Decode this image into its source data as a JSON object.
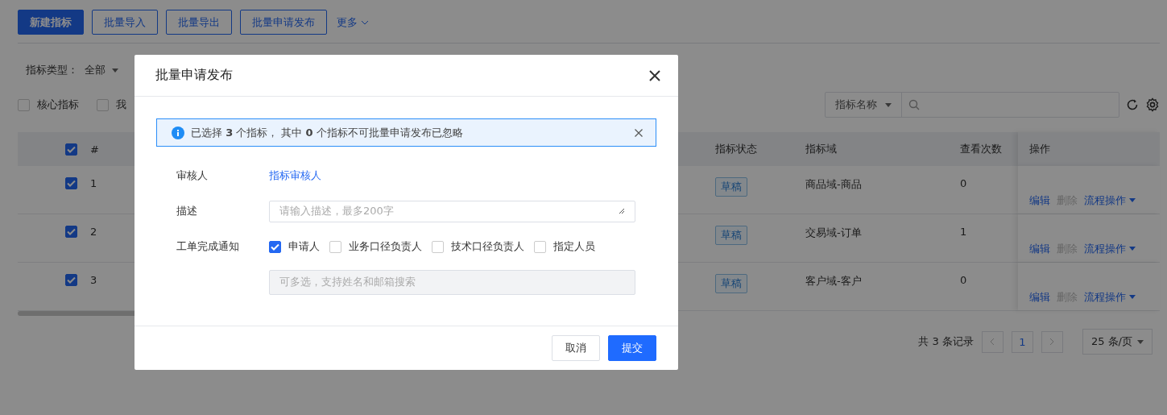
{
  "toolbar": [
    {
      "label": "新建指标",
      "kind": "primary"
    },
    {
      "label": "批量导入",
      "kind": "outline"
    },
    {
      "label": "批量导出",
      "kind": "outline"
    },
    {
      "label": "批量申请发布",
      "kind": "outline"
    },
    {
      "label": "更多",
      "kind": "dropdown"
    }
  ],
  "filter": {
    "label": "指标类型：",
    "value": "全部"
  },
  "quick_filters": [
    {
      "label": "核心指标",
      "checked": false
    },
    {
      "label": "我",
      "checked": false
    }
  ],
  "search": {
    "field": "指标名称"
  },
  "table": {
    "all_checked": true,
    "columns": [
      "#",
      "指标状态",
      "指标域",
      "查看次数",
      "操作"
    ],
    "rows": [
      {
        "checked": true,
        "index": "1",
        "status": "草稿",
        "domain": "商品域-商品",
        "views": "0",
        "actions": [
          {
            "label": "编辑",
            "disabled": false
          },
          {
            "label": "删除",
            "disabled": true
          },
          {
            "label": "流程操作",
            "disabled": false
          }
        ]
      },
      {
        "checked": true,
        "index": "2",
        "status": "草稿",
        "domain": "交易域-订单",
        "views": "1",
        "actions": [
          {
            "label": "编辑",
            "disabled": false
          },
          {
            "label": "删除",
            "disabled": true
          },
          {
            "label": "流程操作",
            "disabled": false
          }
        ]
      },
      {
        "checked": true,
        "index": "3",
        "status": "草稿",
        "domain": "客户域-客户",
        "views": "0",
        "actions": [
          {
            "label": "编辑",
            "disabled": false
          },
          {
            "label": "删除",
            "disabled": true
          },
          {
            "label": "流程操作",
            "disabled": false
          }
        ]
      }
    ]
  },
  "pagination": {
    "total": "共 3 条记录",
    "pages": [
      {
        "label": "1",
        "selected": true
      }
    ],
    "page_size": "25 条/页"
  },
  "modal": {
    "title": "批量申请发布",
    "alert": "已选择 **3** 个指标， 其中 **0** 个指标不可批量申请发布已忽略",
    "reviewer_label": "审核人",
    "reviewer": "指标审核人",
    "description_label": "描述",
    "description_placeholder": "请输入描述，最多200字",
    "notify_label": "工单完成通知",
    "notify_options": [
      {
        "label": "申请人",
        "checked": true
      },
      {
        "label": "业务口径负责人",
        "checked": false
      },
      {
        "label": "技术口径负责人",
        "checked": false
      },
      {
        "label": "指定人员",
        "checked": false
      }
    ],
    "people_placeholder": "可多选，支持姓名和邮箱搜索",
    "buttons": [
      {
        "label": "取消",
        "kind": "default"
      },
      {
        "label": "提交",
        "kind": "primary"
      }
    ]
  }
}
